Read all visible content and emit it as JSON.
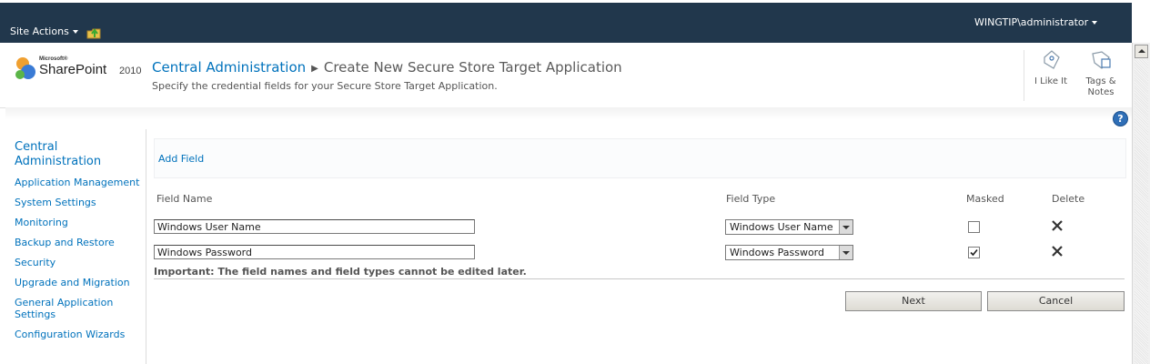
{
  "topbar": {
    "site_actions": "Site Actions",
    "user": "WINGTIP\\administrator"
  },
  "logo": {
    "microsoft": "Microsoft®",
    "product": "SharePoint",
    "year": "2010"
  },
  "breadcrumb": {
    "root": "Central Administration",
    "current": "Create New Secure Store Target Application"
  },
  "subtitle": "Specify the credential fields for your Secure Store Target Application.",
  "social": {
    "i_like_it": "I Like It",
    "tags_notes_line1": "Tags &",
    "tags_notes_line2": "Notes"
  },
  "help_glyph": "?",
  "leftnav": {
    "heading_line1": "Central",
    "heading_line2": "Administration",
    "items": [
      "Application Management",
      "System Settings",
      "Monitoring",
      "Backup and Restore",
      "Security",
      "Upgrade and Migration"
    ],
    "general_line1": "General Application",
    "general_line2": "Settings",
    "last": "Configuration Wizards"
  },
  "toolbar": {
    "add_field": "Add Field"
  },
  "columns": {
    "field_name": "Field Name",
    "field_type": "Field Type",
    "masked": "Masked",
    "delete": "Delete"
  },
  "rows": [
    {
      "name": "Windows User Name",
      "type": "Windows User Name",
      "masked": false
    },
    {
      "name": "Windows Password",
      "type": "Windows Password",
      "masked": true
    }
  ],
  "important": "Important: The field names and field types cannot be edited later.",
  "buttons": {
    "next": "Next",
    "cancel": "Cancel"
  },
  "colors": {
    "topbar": "#21374c",
    "link": "#0072bc"
  },
  "icons": [
    "navigate-up-icon",
    "i-like-it-icon",
    "tags-notes-icon",
    "help-icon",
    "delete-x-icon",
    "dropdown-arrow-icon",
    "scroll-up-icon"
  ]
}
